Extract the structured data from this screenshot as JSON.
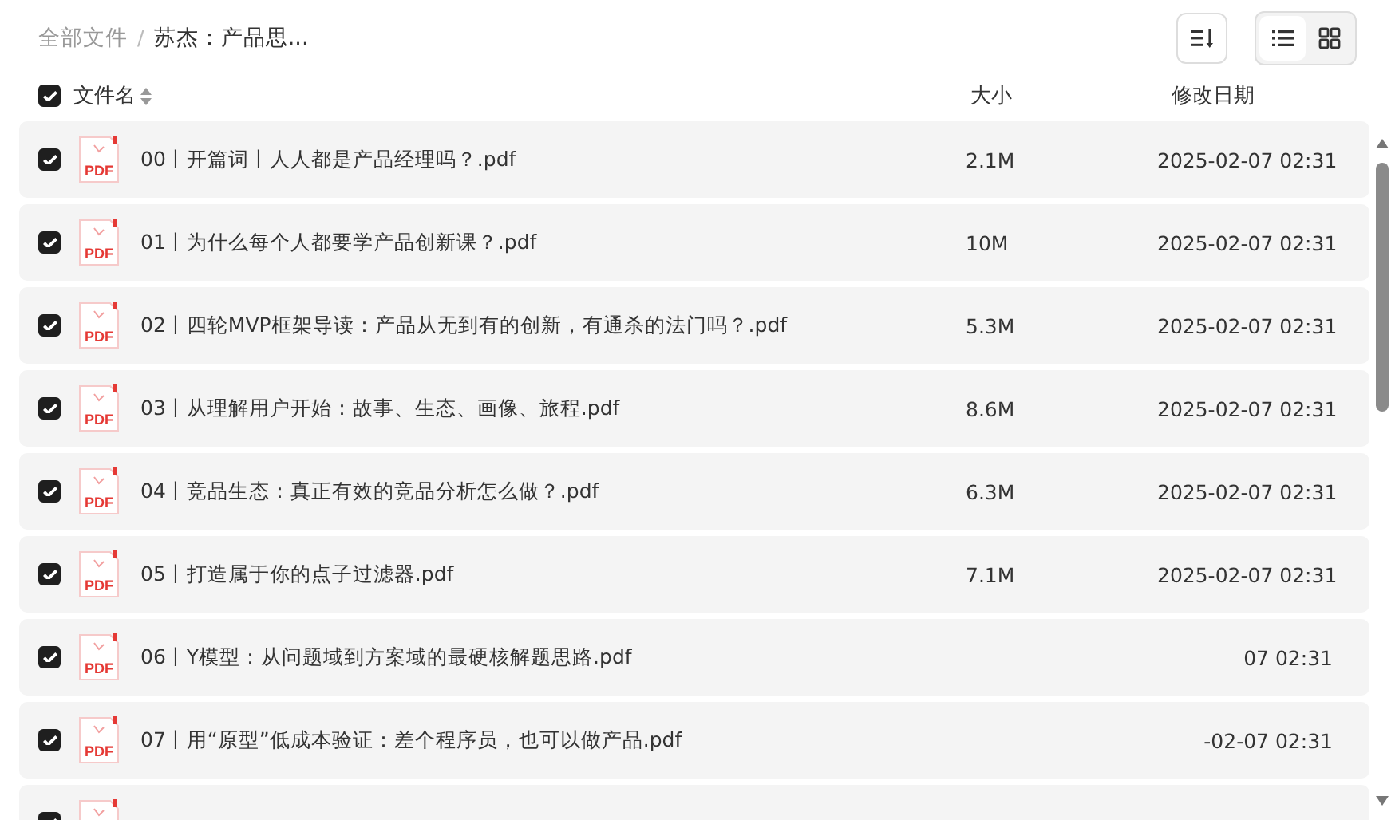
{
  "breadcrumb_separator": "/",
  "breadcrumb": [
    {
      "label": "全部文件",
      "current": false
    },
    {
      "label": "苏杰：产品思...",
      "current": true
    }
  ],
  "view_toggle": [
    {
      "kind": "list",
      "selected": true
    },
    {
      "kind": "grid",
      "selected": false
    }
  ],
  "table": {
    "select_all": {
      "checked": true
    },
    "columns": [
      "文件名",
      "大小",
      "修改日期"
    ],
    "rows": [
      {
        "checked": true,
        "icon_label": "PDF",
        "name": "00丨开篇词丨人人都是产品经理吗？.pdf",
        "size": "2.1M",
        "date": "2025-02-07 02:31"
      },
      {
        "checked": true,
        "icon_label": "PDF",
        "name": "01丨为什么每个人都要学产品创新课？.pdf",
        "size": "10M",
        "date": "2025-02-07 02:31"
      },
      {
        "checked": true,
        "icon_label": "PDF",
        "name": "02丨四轮MVP框架导读：产品从无到有的创新，有通杀的法门吗？.pdf",
        "size": "5.3M",
        "date": "2025-02-07 02:31"
      },
      {
        "checked": true,
        "icon_label": "PDF",
        "name": "03丨从理解用户开始：故事、生态、画像、旅程.pdf",
        "size": "8.6M",
        "date": "2025-02-07 02:31"
      },
      {
        "checked": true,
        "icon_label": "PDF",
        "name": "04丨竞品生态：真正有效的竞品分析怎么做？.pdf",
        "size": "6.3M",
        "date": "2025-02-07 02:31"
      },
      {
        "checked": true,
        "icon_label": "PDF",
        "name": "05丨打造属于你的点子过滤器.pdf",
        "size": "7.1M",
        "date": "2025-02-07 02:31"
      },
      {
        "checked": true,
        "icon_label": "PDF",
        "name": "06丨Y模型：从问题域到方案域的最硬核解题思路.pdf",
        "date": "07 02:31"
      },
      {
        "checked": true,
        "icon_label": "PDF",
        "name": "07丨用“原型”低成本验证：差个程序员，也可以做产品.pdf",
        "date": "-02-07 02:31"
      },
      {
        "checked": true
      }
    ]
  }
}
